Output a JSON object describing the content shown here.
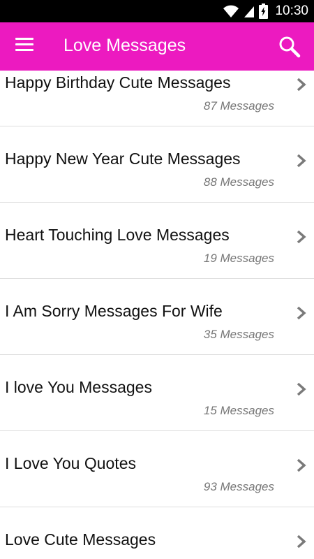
{
  "status_bar": {
    "time": "10:30",
    "icons": [
      "wifi-icon",
      "cell-signal-icon",
      "battery-charging-icon"
    ]
  },
  "app_bar": {
    "title": "Love Messages",
    "accent_color": "#ec1ac0",
    "icons": [
      "menu-icon",
      "search-icon"
    ]
  },
  "list": {
    "items": [
      {
        "title": "Happy Birthday Cute Messages",
        "count": "87 Messages"
      },
      {
        "title": "Happy New Year Cute Messages",
        "count": "88 Messages"
      },
      {
        "title": "Heart Touching Love Messages",
        "count": "19 Messages"
      },
      {
        "title": "I Am Sorry Messages For Wife",
        "count": "35 Messages"
      },
      {
        "title": "I love You Messages",
        "count": "15 Messages"
      },
      {
        "title": "I Love You Quotes",
        "count": "93 Messages"
      },
      {
        "title": "Love Cute Messages",
        "count": ""
      }
    ]
  }
}
